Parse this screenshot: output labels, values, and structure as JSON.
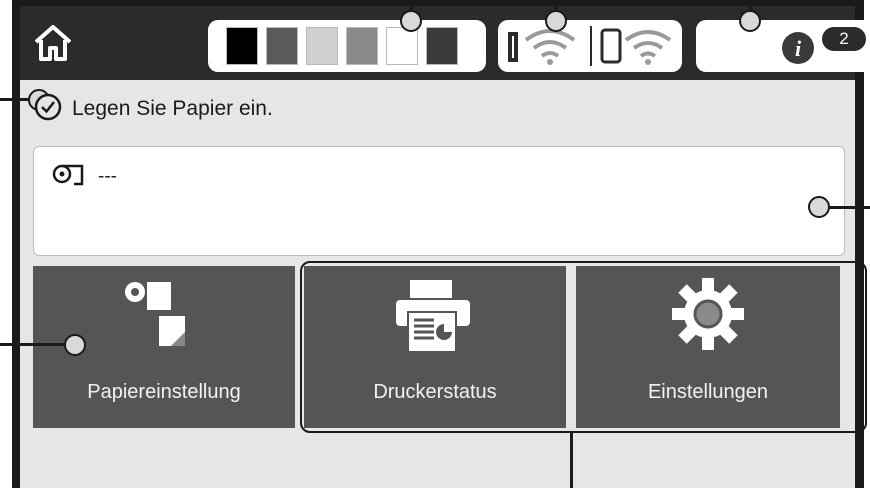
{
  "top_bar": {
    "home_icon": "home-icon",
    "ink_status": {
      "icon": "ink-level-icon",
      "levels": [
        {
          "color": "#000000",
          "level": 1.0
        },
        {
          "color": "#5a5a5a",
          "level": 1.0
        },
        {
          "color": "#d0d0d0",
          "level": 1.0
        },
        {
          "color": "#8a8a8a",
          "level": 1.0
        },
        {
          "color": "#ffffff",
          "level": 0.0
        },
        {
          "color": "#3b3b3b",
          "level": 1.0
        }
      ]
    },
    "network_status": {
      "icons": [
        "wifi-icon",
        "wifi-direct-icon"
      ]
    },
    "info": {
      "icon": "info-icon",
      "count": "2"
    }
  },
  "status": {
    "icon": "checkmark-circle-icon",
    "message": "Legen Sie Papier ein."
  },
  "paper_info": {
    "icon": "roll-paper-icon",
    "value": "---"
  },
  "tiles": [
    {
      "label": "Papiereinstellung",
      "icon": "paper-setting-icon"
    },
    {
      "label": "Druckerstatus",
      "icon": "printer-status-icon"
    },
    {
      "label": "Einstellungen",
      "icon": "settings-gear-icon"
    }
  ],
  "colors": {
    "bezel": "#1a1a1a",
    "screen_bg": "#e6e6e6",
    "topbar_bg": "#2b2b2b",
    "tile_bg": "#555555"
  }
}
